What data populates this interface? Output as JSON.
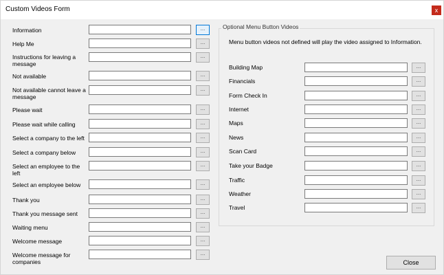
{
  "window": {
    "title": "Custom Videos Form",
    "close_glyph": "x"
  },
  "browse_label": "...",
  "left_fields": [
    {
      "label": "Information"
    },
    {
      "label": "Help Me"
    },
    {
      "label": "Instructions for leaving a message"
    },
    {
      "label": "Not available"
    },
    {
      "label": "Not available cannot leave a message"
    },
    {
      "label": "Please wait"
    },
    {
      "label": "Please wait while calling"
    },
    {
      "label": "Select a company to the left"
    },
    {
      "label": "Select a company below"
    },
    {
      "label": "Select an employee to the left"
    },
    {
      "label": "Select an employee below"
    },
    {
      "label": "Thank you"
    },
    {
      "label": "Thank you message sent"
    },
    {
      "label": "Waiting menu"
    },
    {
      "label": "Welcome message"
    },
    {
      "label": "Welcome message for companies"
    }
  ],
  "group": {
    "title": "Optional Menu Button Videos",
    "note": "Menu button videos not defined will play the video assigned to Information.",
    "fields": [
      {
        "label": "Building Map"
      },
      {
        "label": "Financials"
      },
      {
        "label": "Form Check In"
      },
      {
        "label": "Internet"
      },
      {
        "label": "Maps"
      },
      {
        "label": "News"
      },
      {
        "label": "Scan Card"
      },
      {
        "label": "Take your Badge"
      },
      {
        "label": "Traffic"
      },
      {
        "label": "Weather"
      },
      {
        "label": "Travel"
      }
    ]
  },
  "close_button": "Close"
}
